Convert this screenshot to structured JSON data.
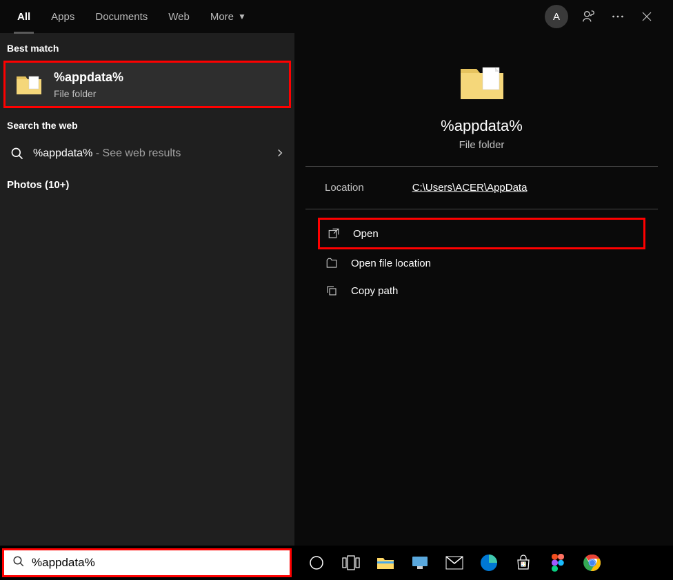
{
  "tabs": {
    "all": "All",
    "apps": "Apps",
    "documents": "Documents",
    "web": "Web",
    "more": "More"
  },
  "avatar_letter": "A",
  "left": {
    "best_match_header": "Best match",
    "best_match": {
      "title": "%appdata%",
      "subtitle": "File folder"
    },
    "search_web_header": "Search the web",
    "web_result": {
      "term": "%appdata%",
      "suffix": " - See web results"
    },
    "photos_header": "Photos (10+)"
  },
  "preview": {
    "title": "%appdata%",
    "subtitle": "File folder",
    "location_label": "Location",
    "location_path": "C:\\Users\\ACER\\AppData",
    "actions": {
      "open": "Open",
      "open_location": "Open file location",
      "copy_path": "Copy path"
    }
  },
  "search_input": "%appdata%"
}
